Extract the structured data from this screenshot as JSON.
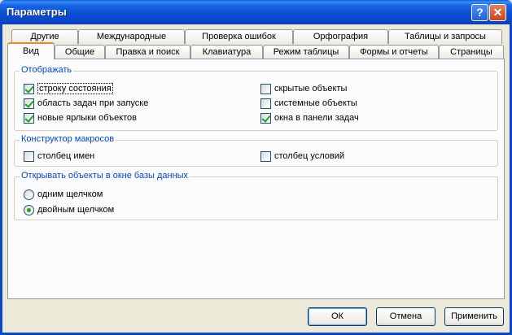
{
  "window": {
    "title": "Параметры",
    "help_label": "?",
    "close_label": "✕"
  },
  "tabs_back": [
    {
      "label": "Другие"
    },
    {
      "label": "Международные"
    },
    {
      "label": "Проверка ошибок"
    },
    {
      "label": "Орфография"
    },
    {
      "label": "Таблицы и запросы"
    }
  ],
  "tabs_front": [
    {
      "label": "Вид",
      "active": true
    },
    {
      "label": "Общие"
    },
    {
      "label": "Правка и поиск"
    },
    {
      "label": "Клавиатура"
    },
    {
      "label": "Режим таблицы"
    },
    {
      "label": "Формы и отчеты"
    },
    {
      "label": "Страницы"
    }
  ],
  "show_group": {
    "title": "Отображать",
    "options": [
      {
        "label": "строку состояния",
        "checked": true
      },
      {
        "label": "область задач при запуске",
        "checked": true
      },
      {
        "label": "новые ярлыки объектов",
        "checked": true
      },
      {
        "label": "скрытые объекты",
        "checked": false
      },
      {
        "label": "системные объекты",
        "checked": false
      },
      {
        "label": "окна в панели задач",
        "checked": true
      }
    ]
  },
  "macro_group": {
    "title": "Конструктор макросов",
    "options": [
      {
        "label": "столбец имен",
        "checked": false
      },
      {
        "label": "столбец условий",
        "checked": false
      }
    ]
  },
  "open_group": {
    "title": "Открывать объекты в окне базы данных",
    "options": [
      {
        "label": "одним щелчком",
        "selected": false
      },
      {
        "label": "двойным щелчком",
        "selected": true
      }
    ]
  },
  "buttons": {
    "ok": "ОК",
    "cancel": "Отмена",
    "apply": "Применить"
  }
}
